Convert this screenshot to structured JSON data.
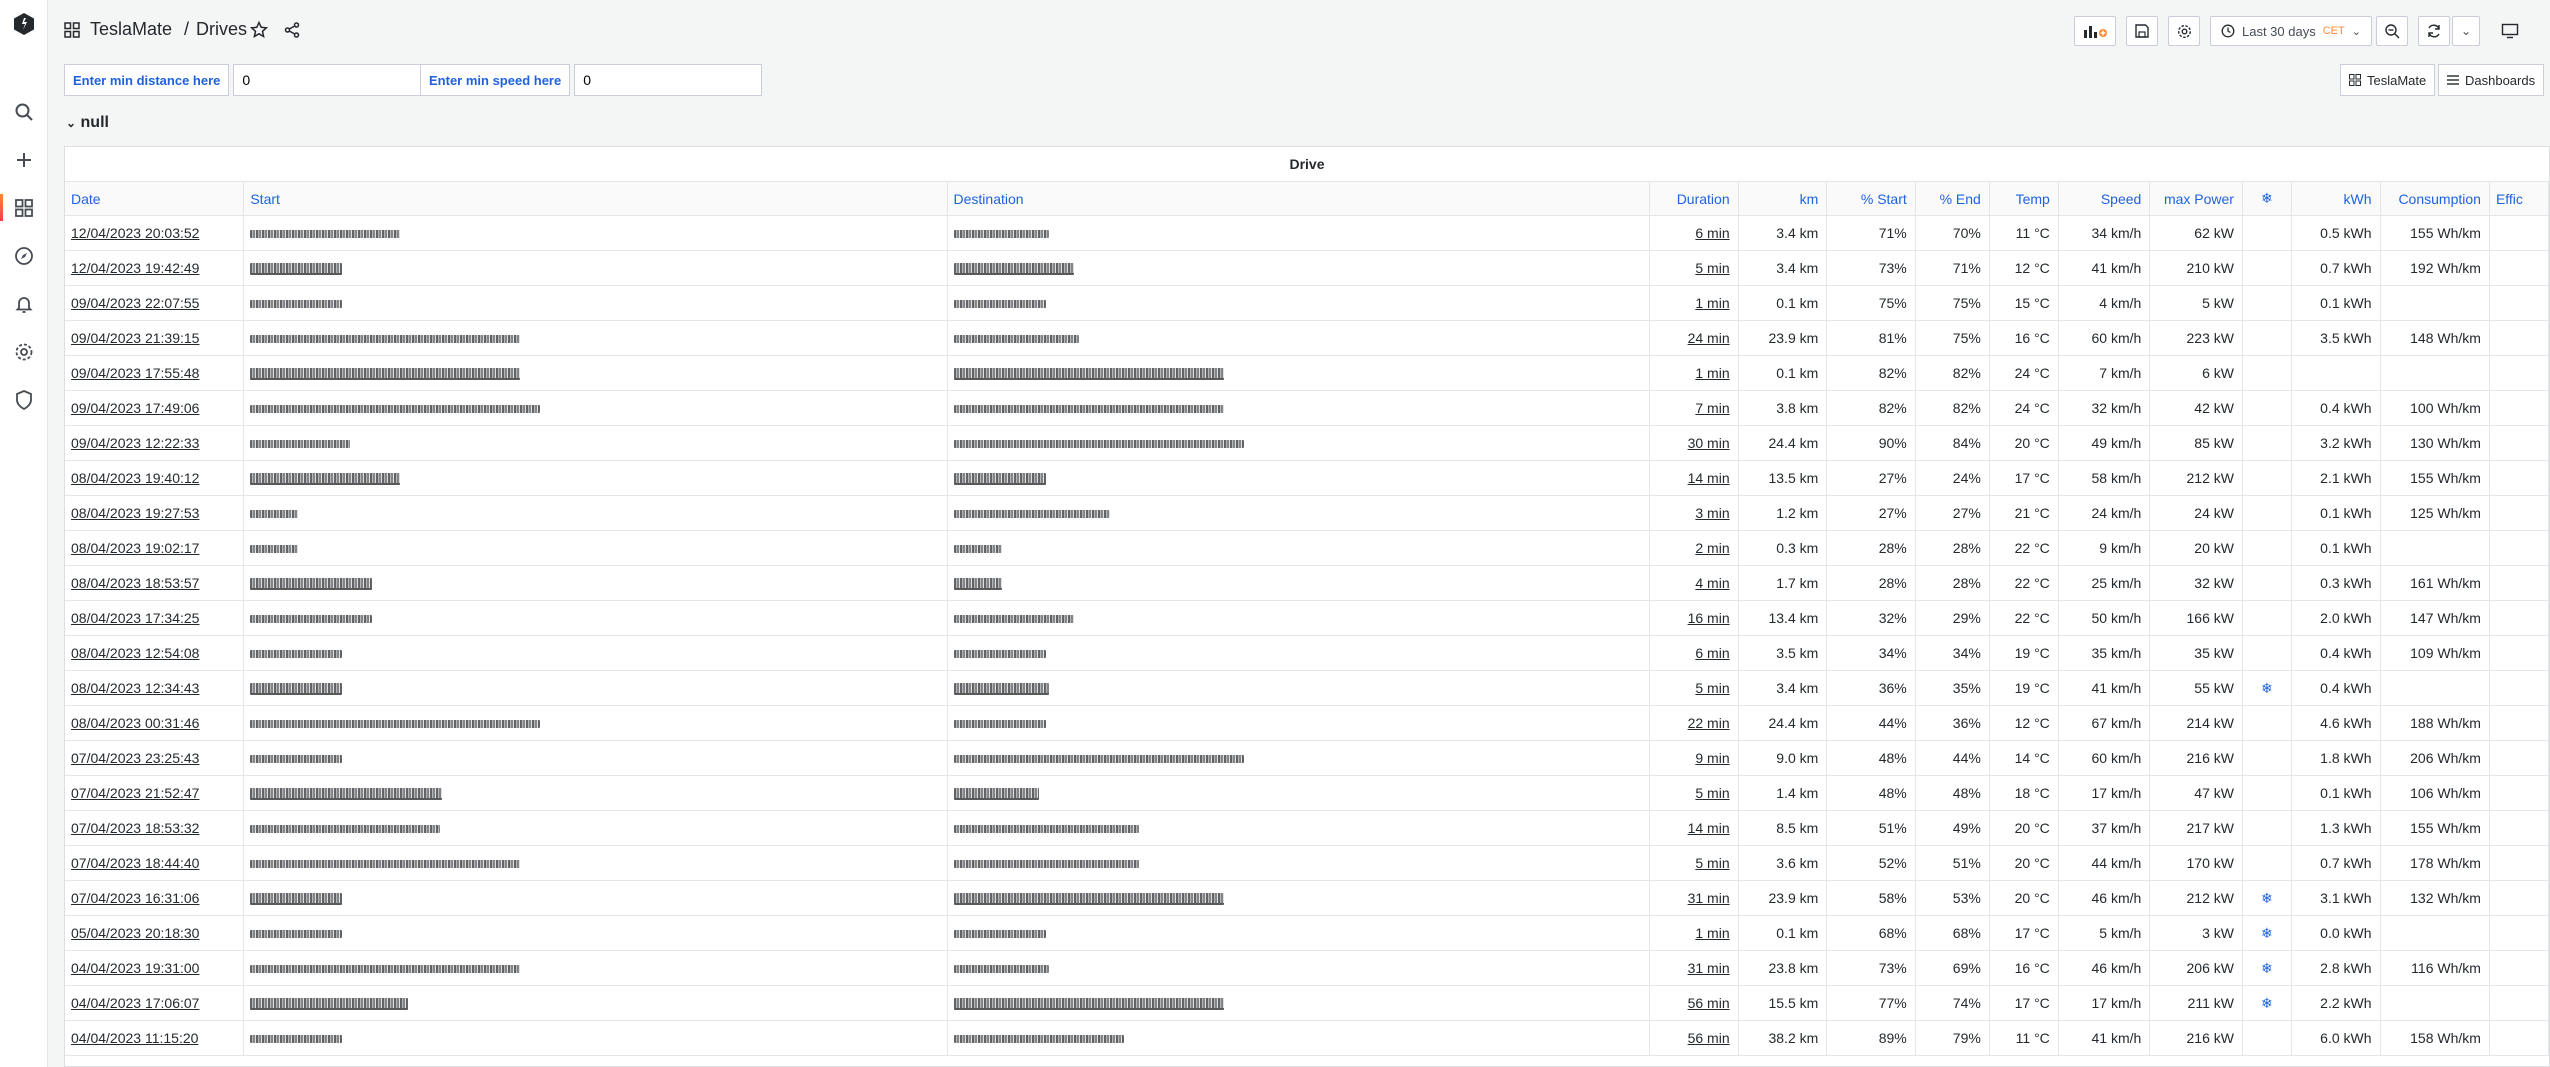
{
  "breadcrumb": {
    "home": "TeslaMate",
    "separator": "/",
    "page": "Drives"
  },
  "toolbar": {
    "time_range": "Last 30 days",
    "timezone": "CET"
  },
  "variables": [
    {
      "label": "Enter min distance here",
      "value": "0"
    },
    {
      "label": "Enter min speed here",
      "value": "0"
    }
  ],
  "dash_links": {
    "teslamate": "TeslaMate",
    "dashboards": "Dashboards"
  },
  "row_title": "null",
  "panel": {
    "title": "Drive"
  },
  "columns": [
    "Date",
    "Start",
    "Destination",
    "Duration",
    "km",
    "% Start",
    "% End",
    "Temp",
    "Speed",
    "max Power",
    "❄",
    "kWh",
    "Consumption",
    "Effic"
  ],
  "rows": [
    {
      "date": "12/04/2023 20:03:52",
      "duration": "6 min",
      "km": "3.4 km",
      "ps": "71%",
      "pe": "70%",
      "temp": "11 °C",
      "speed": "34 km/h",
      "power": "62 kW",
      "snow": "",
      "kwh": "0.5 kWh",
      "cons": "155 Wh/km"
    },
    {
      "date": "12/04/2023 19:42:49",
      "duration": "5 min",
      "km": "3.4 km",
      "ps": "73%",
      "pe": "71%",
      "temp": "12 °C",
      "speed": "41 km/h",
      "power": "210 kW",
      "snow": "",
      "kwh": "0.7 kWh",
      "cons": "192 Wh/km"
    },
    {
      "date": "09/04/2023 22:07:55",
      "duration": "1 min",
      "km": "0.1 km",
      "ps": "75%",
      "pe": "75%",
      "temp": "15 °C",
      "speed": "4 km/h",
      "power": "5 kW",
      "snow": "",
      "kwh": "0.1 kWh",
      "cons": ""
    },
    {
      "date": "09/04/2023 21:39:15",
      "duration": "24 min",
      "km": "23.9 km",
      "ps": "81%",
      "pe": "75%",
      "temp": "16 °C",
      "speed": "60 km/h",
      "power": "223 kW",
      "snow": "",
      "kwh": "3.5 kWh",
      "cons": "148 Wh/km"
    },
    {
      "date": "09/04/2023 17:55:48",
      "duration": "1 min",
      "km": "0.1 km",
      "ps": "82%",
      "pe": "82%",
      "temp": "24 °C",
      "speed": "7 km/h",
      "power": "6 kW",
      "snow": "",
      "kwh": "",
      "cons": ""
    },
    {
      "date": "09/04/2023 17:49:06",
      "duration": "7 min",
      "km": "3.8 km",
      "ps": "82%",
      "pe": "82%",
      "temp": "24 °C",
      "speed": "32 km/h",
      "power": "42 kW",
      "snow": "",
      "kwh": "0.4 kWh",
      "cons": "100 Wh/km"
    },
    {
      "date": "09/04/2023 12:22:33",
      "duration": "30 min",
      "km": "24.4 km",
      "ps": "90%",
      "pe": "84%",
      "temp": "20 °C",
      "speed": "49 km/h",
      "power": "85 kW",
      "snow": "",
      "kwh": "3.2 kWh",
      "cons": "130 Wh/km"
    },
    {
      "date": "08/04/2023 19:40:12",
      "duration": "14 min",
      "km": "13.5 km",
      "ps": "27%",
      "pe": "24%",
      "temp": "17 °C",
      "speed": "58 km/h",
      "power": "212 kW",
      "snow": "",
      "kwh": "2.1 kWh",
      "cons": "155 Wh/km"
    },
    {
      "date": "08/04/2023 19:27:53",
      "duration": "3 min",
      "km": "1.2 km",
      "ps": "27%",
      "pe": "27%",
      "temp": "21 °C",
      "speed": "24 km/h",
      "power": "24 kW",
      "snow": "",
      "kwh": "0.1 kWh",
      "cons": "125 Wh/km"
    },
    {
      "date": "08/04/2023 19:02:17",
      "duration": "2 min",
      "km": "0.3 km",
      "ps": "28%",
      "pe": "28%",
      "temp": "22 °C",
      "speed": "9 km/h",
      "power": "20 kW",
      "snow": "",
      "kwh": "0.1 kWh",
      "cons": ""
    },
    {
      "date": "08/04/2023 18:53:57",
      "duration": "4 min",
      "km": "1.7 km",
      "ps": "28%",
      "pe": "28%",
      "temp": "22 °C",
      "speed": "25 km/h",
      "power": "32 kW",
      "snow": "",
      "kwh": "0.3 kWh",
      "cons": "161 Wh/km"
    },
    {
      "date": "08/04/2023 17:34:25",
      "duration": "16 min",
      "km": "13.4 km",
      "ps": "32%",
      "pe": "29%",
      "temp": "22 °C",
      "speed": "50 km/h",
      "power": "166 kW",
      "snow": "",
      "kwh": "2.0 kWh",
      "cons": "147 Wh/km"
    },
    {
      "date": "08/04/2023 12:54:08",
      "duration": "6 min",
      "km": "3.5 km",
      "ps": "34%",
      "pe": "34%",
      "temp": "19 °C",
      "speed": "35 km/h",
      "power": "35 kW",
      "snow": "",
      "kwh": "0.4 kWh",
      "cons": "109 Wh/km"
    },
    {
      "date": "08/04/2023 12:34:43",
      "duration": "5 min",
      "km": "3.4 km",
      "ps": "36%",
      "pe": "35%",
      "temp": "19 °C",
      "speed": "41 km/h",
      "power": "55 kW",
      "snow": "❄",
      "kwh": "0.4 kWh",
      "cons": ""
    },
    {
      "date": "08/04/2023 00:31:46",
      "duration": "22 min",
      "km": "24.4 km",
      "ps": "44%",
      "pe": "36%",
      "temp": "12 °C",
      "speed": "67 km/h",
      "power": "214 kW",
      "snow": "",
      "kwh": "4.6 kWh",
      "cons": "188 Wh/km"
    },
    {
      "date": "07/04/2023 23:25:43",
      "duration": "9 min",
      "km": "9.0 km",
      "ps": "48%",
      "pe": "44%",
      "temp": "14 °C",
      "speed": "60 km/h",
      "power": "216 kW",
      "snow": "",
      "kwh": "1.8 kWh",
      "cons": "206 Wh/km"
    },
    {
      "date": "07/04/2023 21:52:47",
      "duration": "5 min",
      "km": "1.4 km",
      "ps": "48%",
      "pe": "48%",
      "temp": "18 °C",
      "speed": "17 km/h",
      "power": "47 kW",
      "snow": "",
      "kwh": "0.1 kWh",
      "cons": "106 Wh/km"
    },
    {
      "date": "07/04/2023 18:53:32",
      "duration": "14 min",
      "km": "8.5 km",
      "ps": "51%",
      "pe": "49%",
      "temp": "20 °C",
      "speed": "37 km/h",
      "power": "217 kW",
      "snow": "",
      "kwh": "1.3 kWh",
      "cons": "155 Wh/km"
    },
    {
      "date": "07/04/2023 18:44:40",
      "duration": "5 min",
      "km": "3.6 km",
      "ps": "52%",
      "pe": "51%",
      "temp": "20 °C",
      "speed": "44 km/h",
      "power": "170 kW",
      "snow": "",
      "kwh": "0.7 kWh",
      "cons": "178 Wh/km"
    },
    {
      "date": "07/04/2023 16:31:06",
      "duration": "31 min",
      "km": "23.9 km",
      "ps": "58%",
      "pe": "53%",
      "temp": "20 °C",
      "speed": "46 km/h",
      "power": "212 kW",
      "snow": "❄",
      "kwh": "3.1 kWh",
      "cons": "132 Wh/km"
    },
    {
      "date": "05/04/2023 20:18:30",
      "duration": "1 min",
      "km": "0.1 km",
      "ps": "68%",
      "pe": "68%",
      "temp": "17 °C",
      "speed": "5 km/h",
      "power": "3 kW",
      "snow": "❄",
      "kwh": "0.0 kWh",
      "cons": ""
    },
    {
      "date": "04/04/2023 19:31:00",
      "duration": "31 min",
      "km": "23.8 km",
      "ps": "73%",
      "pe": "69%",
      "temp": "16 °C",
      "speed": "46 km/h",
      "power": "206 kW",
      "snow": "❄",
      "kwh": "2.8 kWh",
      "cons": "116 Wh/km"
    },
    {
      "date": "04/04/2023 17:06:07",
      "duration": "56 min",
      "km": "15.5 km",
      "ps": "77%",
      "pe": "74%",
      "temp": "17 °C",
      "speed": "17 km/h",
      "power": "211 kW",
      "snow": "❄",
      "kwh": "2.2 kWh",
      "cons": ""
    },
    {
      "date": "04/04/2023 11:15:20",
      "duration": "56 min",
      "km": "38.2 km",
      "ps": "89%",
      "pe": "79%",
      "temp": "11 °C",
      "speed": "41 km/h",
      "power": "216 kW",
      "snow": "",
      "kwh": "6.0 kWh",
      "cons": "158 Wh/km"
    }
  ]
}
